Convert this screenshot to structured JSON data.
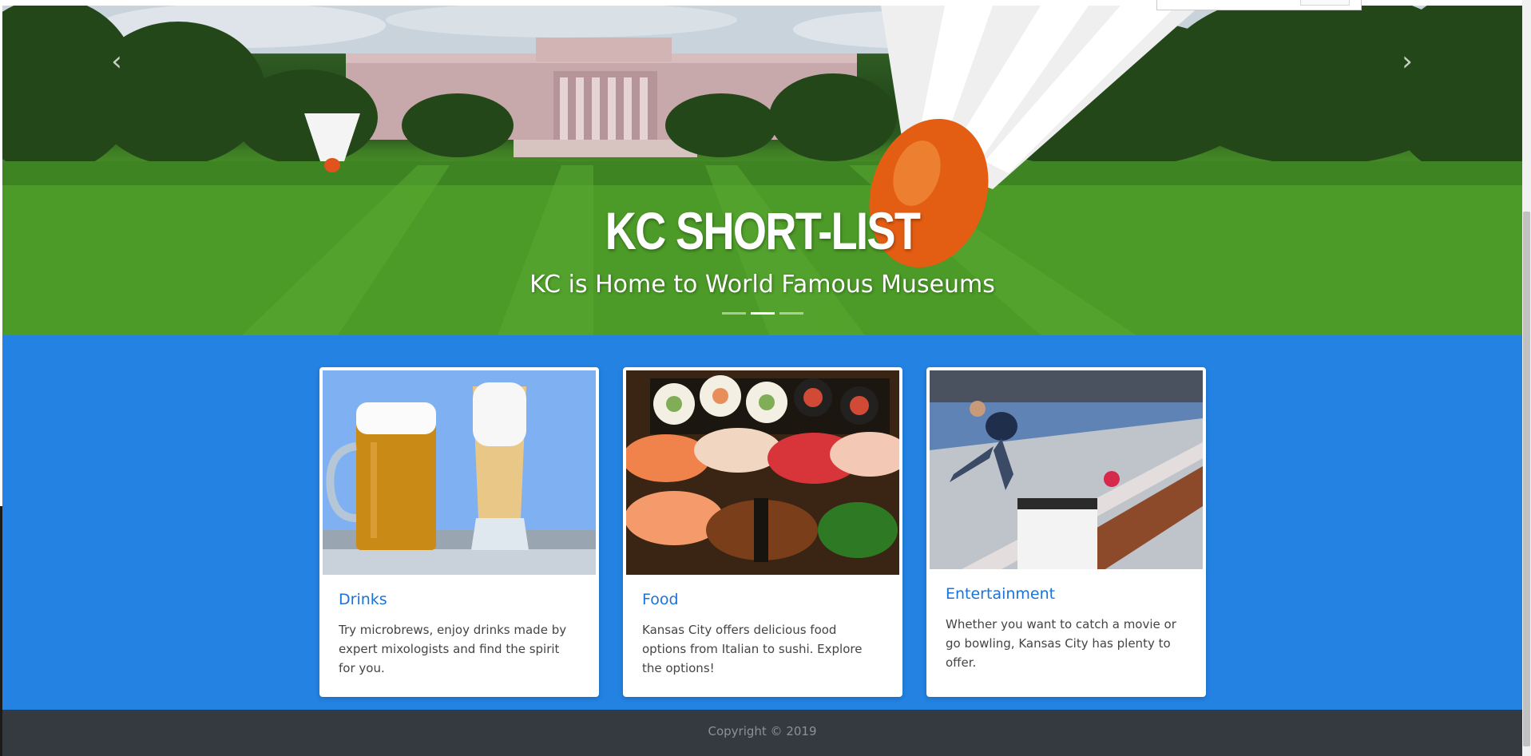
{
  "hero": {
    "title": "KC SHORT-LIST",
    "subtitle": "KC is Home to World Famous Museums",
    "prev_icon": "chevron-left-icon",
    "next_icon": "chevron-right-icon",
    "prev_glyph": "‹",
    "next_glyph": "›",
    "slides_count": 3,
    "active_slide": 2
  },
  "cards": [
    {
      "title": "Drinks",
      "text": "Try microbrews, enjoy drinks made by expert mixologists and find the spirit for you."
    },
    {
      "title": "Food",
      "text": "Kansas City offers delicious food options from Italian to sushi. Explore the options!"
    },
    {
      "title": "Entertainment",
      "text": "Whether you want to catch a movie or go bowling, Kansas City has plenty to offer."
    }
  ],
  "footer": {
    "copyright": "Copyright © 2019"
  },
  "colors": {
    "section_blue": "#2382e2",
    "card_title": "#1a73d9",
    "footer_bg": "#343a40",
    "footer_text": "#8c9197"
  }
}
